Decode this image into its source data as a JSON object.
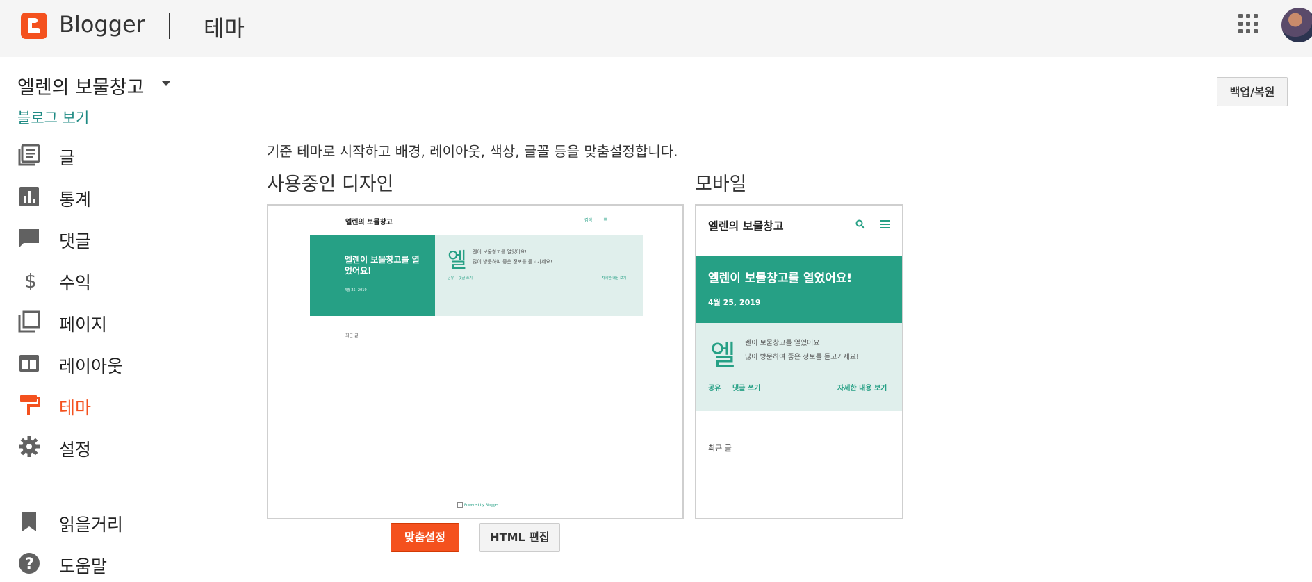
{
  "header": {
    "brand": "Blogger",
    "page_title": "테마",
    "accent_color": "#f4511e",
    "apps_icon": "apps-grid-icon",
    "avatar_icon": "account-avatar"
  },
  "blog": {
    "name": "엘렌의 보물창고",
    "view_link": "블로그 보기"
  },
  "sidebar": {
    "items": [
      {
        "label": "글",
        "icon": "posts-icon"
      },
      {
        "label": "통계",
        "icon": "stats-icon"
      },
      {
        "label": "댓글",
        "icon": "comments-icon"
      },
      {
        "label": "수익",
        "icon": "earnings-icon"
      },
      {
        "label": "페이지",
        "icon": "pages-icon"
      },
      {
        "label": "레이아웃",
        "icon": "layout-icon"
      },
      {
        "label": "테마",
        "icon": "theme-icon",
        "active": true
      },
      {
        "label": "설정",
        "icon": "settings-icon"
      }
    ],
    "secondary": [
      {
        "label": "읽을거리",
        "icon": "bookmark-icon"
      },
      {
        "label": "도움말",
        "icon": "help-icon"
      }
    ]
  },
  "main": {
    "backup_button": "백업/복원",
    "description": "기준 테마로 시작하고 배경, 레이아웃, 색상, 글꼴 등을 맞춤설정합니다.",
    "current_design_heading": "사용중인 디자인",
    "mobile_heading": "모바일",
    "customize_button": "맞춤설정",
    "edit_html_button": "HTML 편집"
  },
  "desktop_preview": {
    "blog_title": "엘렌의 보물창고",
    "nav_text": "검색",
    "post_title": "엘렌이 보물창고를 열었어요!",
    "post_date": "4월 25, 2019",
    "snippet_letter": "엘",
    "snippet_line1": "렌이 보물창고를 열었어요!",
    "snippet_line2": "많이 방문하여 좋은 정보를 듣고가세요!",
    "share": "공유",
    "comment": "댓글 쓰기",
    "read_more": "자세한 내용 보기",
    "recent": "최근 글",
    "footer": "Powered by Blogger"
  },
  "mobile_preview": {
    "blog_title": "엘렌의 보물창고",
    "post_title": "엘렌이 보물창고를 열었어요!",
    "post_date": "4월 25, 2019",
    "snippet_letter": "엘",
    "snippet_line1": "렌이 보물창고를 열었어요!",
    "snippet_line2": "많이 방문하여 좋은 정보를 듣고가세요!",
    "share": "공유",
    "comment": "댓글 쓰기",
    "read_more": "자세한 내용 보기",
    "recent": "최근 글",
    "theme_color": "#26a085",
    "light_color": "#e0efec"
  }
}
